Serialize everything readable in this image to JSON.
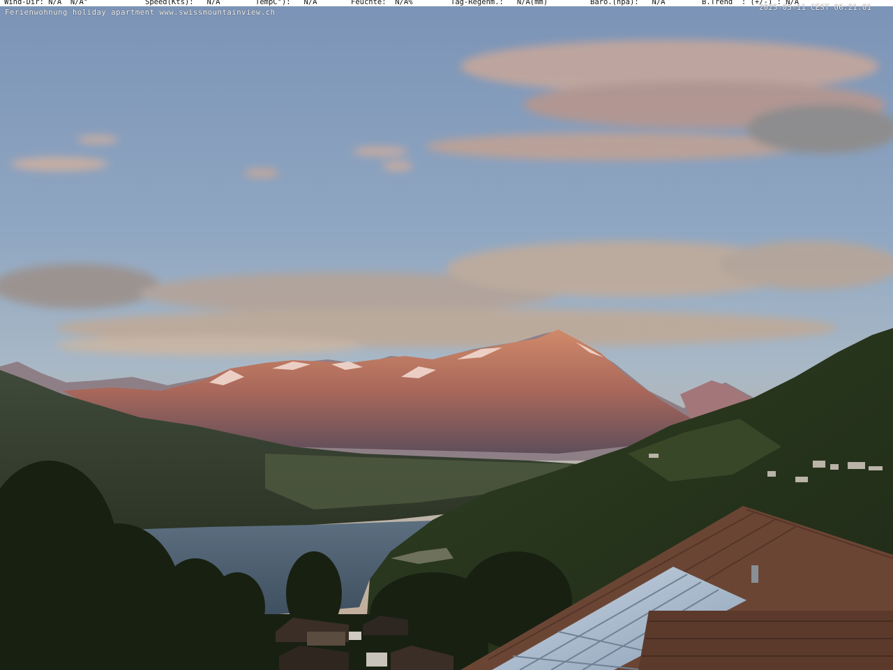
{
  "weather_bar": {
    "wind_dir": "Wind-Dir: N/A  N/A°",
    "speed": "Speed(Kts):   N/A",
    "temp": "TempC°):   N/A",
    "humidity": "Feuchte:  N/A%",
    "rain": "Tag-Regenm.:   N/A(mm)",
    "baro": "Baro.(hpa):   N/A",
    "trend": "B.Trend  : (+/-) : N/A"
  },
  "caption": "Ferienwohnung holiday apartment www.swissmountainview.ch",
  "timestamp": "2025-05-11 CEST 06:21:01",
  "colors": {
    "sky_top": "#7f97b8",
    "sky_mid": "#9fb3c9",
    "horizon": "#c8b5a0",
    "alpenglow": "#c98062",
    "lake": "#4e6170",
    "forest": "#2c3a1e",
    "roof": "#5a3a2a",
    "solar_panel": "#aebfd2"
  }
}
